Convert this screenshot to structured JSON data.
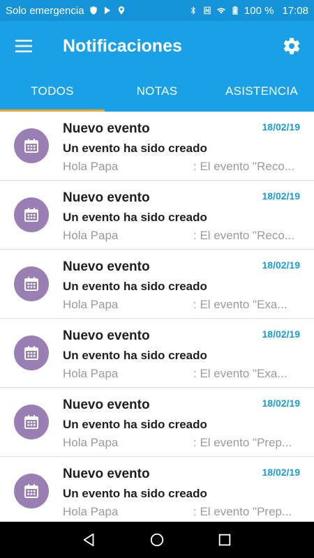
{
  "status_bar": {
    "carrier": "Solo emergencia",
    "battery": "100 %",
    "time": "17:08"
  },
  "header": {
    "title": "Notificaciones"
  },
  "tabs": [
    {
      "label": "TODOS",
      "active": true
    },
    {
      "label": "NOTAS",
      "active": false
    },
    {
      "label": "ASISTENCIA",
      "active": false
    }
  ],
  "notifications": [
    {
      "title": "Nuevo evento",
      "date": "18/02/19",
      "subtitle": "Un evento ha sido creado",
      "greeting": "Hola Papa",
      "preview": ": El evento \"Reco..."
    },
    {
      "title": "Nuevo evento",
      "date": "18/02/19",
      "subtitle": "Un evento ha sido creado",
      "greeting": "Hola Papa",
      "preview": ": El evento \"Reco..."
    },
    {
      "title": "Nuevo evento",
      "date": "18/02/19",
      "subtitle": "Un evento ha sido creado",
      "greeting": "Hola Papa",
      "preview": ": El evento \"Exa..."
    },
    {
      "title": "Nuevo evento",
      "date": "18/02/19",
      "subtitle": "Un evento ha sido creado",
      "greeting": "Hola Papa",
      "preview": ": El evento \"Exa..."
    },
    {
      "title": "Nuevo evento",
      "date": "18/02/19",
      "subtitle": "Un evento ha sido creado",
      "greeting": "Hola Papa",
      "preview": ": El evento \"Prep..."
    },
    {
      "title": "Nuevo evento",
      "date": "18/02/19",
      "subtitle": "Un evento ha sido creado",
      "greeting": "Hola Papa",
      "preview": ": El evento \"Prep..."
    }
  ],
  "colors": {
    "app_bar": "#1aa0e6",
    "status_bar": "#1593d8",
    "tab_indicator": "#f5a623",
    "avatar": "#9a7fb5",
    "date": "#1a9bd6"
  },
  "icons": {
    "menu": "hamburger-menu-icon",
    "settings": "gear-icon",
    "avatar": "calendar-icon",
    "nav_back": "triangle-back-icon",
    "nav_home": "circle-home-icon",
    "nav_recent": "square-recent-icon"
  }
}
